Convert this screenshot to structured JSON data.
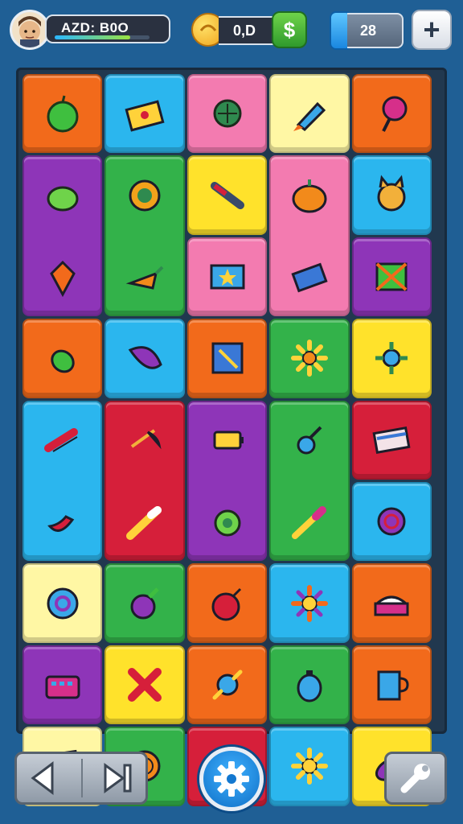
{
  "header": {
    "player_label": "AZD: B0O",
    "xp_progress": 0.8,
    "coins_value": "0,D",
    "add_coins_symbol": "$",
    "gems_value": "28",
    "plus_symbol": "+"
  },
  "board": {
    "columns": 5,
    "rows": 8,
    "tiles": [
      {
        "icon": "apple-icon",
        "color": "#f26a1b"
      },
      {
        "icon": "treasure-chest-icon",
        "color": "#2bb6ee"
      },
      {
        "icon": "turtle-shell-icon",
        "color": "#f37bb0"
      },
      {
        "icon": "rocket-icon",
        "color": "#fff7a4"
      },
      {
        "icon": "lollipop-icon",
        "color": "#f26a1b"
      },
      {
        "icon": "green-apple-icon",
        "color": "#8e35b8"
      },
      {
        "icon": "gear-icon",
        "color": "#33b24a"
      },
      {
        "icon": "knife-icon",
        "color": "#ffe22b"
      },
      {
        "icon": "pumpkin-icon",
        "color": "#f37bb0"
      },
      {
        "icon": "cat-face-icon",
        "color": "#2bb6ee"
      },
      {
        "icon": "kite-icon",
        "color": "#8e35b8"
      },
      {
        "icon": "carrot-icon",
        "color": "#33b24a"
      },
      {
        "icon": "star-card-icon",
        "color": "#f37bb0"
      },
      {
        "icon": "phone-icon",
        "color": "#f37bb0"
      },
      {
        "icon": "crossed-flag-icon",
        "color": "#8e35b8"
      },
      {
        "icon": "bottle-icon",
        "color": "#f26a1b"
      },
      {
        "icon": "cone-icon",
        "color": "#2bb6ee"
      },
      {
        "icon": "paint-frame-icon",
        "color": "#f26a1b"
      },
      {
        "icon": "sunflower-icon",
        "color": "#33b24a"
      },
      {
        "icon": "blue-flower-icon",
        "color": "#ffe22b"
      },
      {
        "icon": "comb-icon",
        "color": "#2bb6ee"
      },
      {
        "icon": "umbrella-icon",
        "color": "#d61f3a"
      },
      {
        "icon": "battery-icon",
        "color": "#8e35b8"
      },
      {
        "icon": "flask-icon",
        "color": "#33b24a"
      },
      {
        "icon": "stripe-card-icon",
        "color": "#d61f3a"
      },
      {
        "icon": "chili-icon",
        "color": "#2bb6ee"
      },
      {
        "icon": "pen-icon",
        "color": "#d61f3a"
      },
      {
        "icon": "green-turtle-icon",
        "color": "#8e35b8"
      },
      {
        "icon": "brush-icon",
        "color": "#33b24a"
      },
      {
        "icon": "swirl-candy-icon",
        "color": "#2bb6ee"
      },
      {
        "icon": "swirl-icon",
        "color": "#fff7a4"
      },
      {
        "icon": "beet-icon",
        "color": "#33b24a"
      },
      {
        "icon": "bomb-icon",
        "color": "#f26a1b"
      },
      {
        "icon": "sun-icon",
        "color": "#2bb6ee"
      },
      {
        "icon": "cake-icon",
        "color": "#f26a1b"
      },
      {
        "icon": "keyboard-icon",
        "color": "#8e35b8"
      },
      {
        "icon": "x-mark-icon",
        "color": "#ffe22b"
      },
      {
        "icon": "blue-star-icon",
        "color": "#f26a1b"
      },
      {
        "icon": "alarm-clock-icon",
        "color": "#33b24a"
      },
      {
        "icon": "mug-icon",
        "color": "#f26a1b"
      },
      {
        "icon": "computer-icon",
        "color": "#fff7a4"
      },
      {
        "icon": "cinnamon-roll-icon",
        "color": "#33b24a"
      },
      {
        "icon": "pineapple-face-icon",
        "color": "#d61f3a"
      },
      {
        "icon": "yellow-flower-icon",
        "color": "#2bb6ee"
      },
      {
        "icon": "eggplant-icon",
        "color": "#ffe22b"
      }
    ]
  },
  "footer": {
    "prev_icon": "left-arrow-icon",
    "next_icon": "skip-forward-icon",
    "center_icon": "settings-gear-icon",
    "tool_icon": "wrench-icon"
  }
}
